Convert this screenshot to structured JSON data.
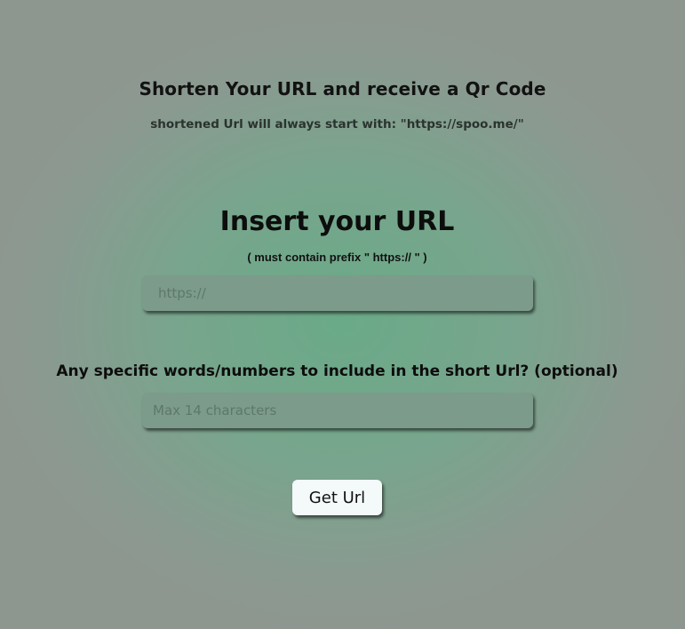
{
  "header": {
    "title": "Shorten Your URL and receive a Qr Code",
    "subtitle": "shortened Url will always start with: \"https://spoo.me/\""
  },
  "url_section": {
    "title": "Insert your URL",
    "hint": "( must contain prefix \" https:// \" )",
    "input_value": "",
    "input_placeholder": "https://"
  },
  "custom_section": {
    "label": "Any specific words/numbers to include in the short Url? (optional)",
    "input_value": "",
    "input_placeholder": "Max 14 characters"
  },
  "actions": {
    "submit_label": "Get Url"
  },
  "colors": {
    "background_center": "#6aaa88",
    "background_edge": "#8e9690",
    "input_background": "#7c9b8a",
    "button_background": "#f4f9fa"
  }
}
